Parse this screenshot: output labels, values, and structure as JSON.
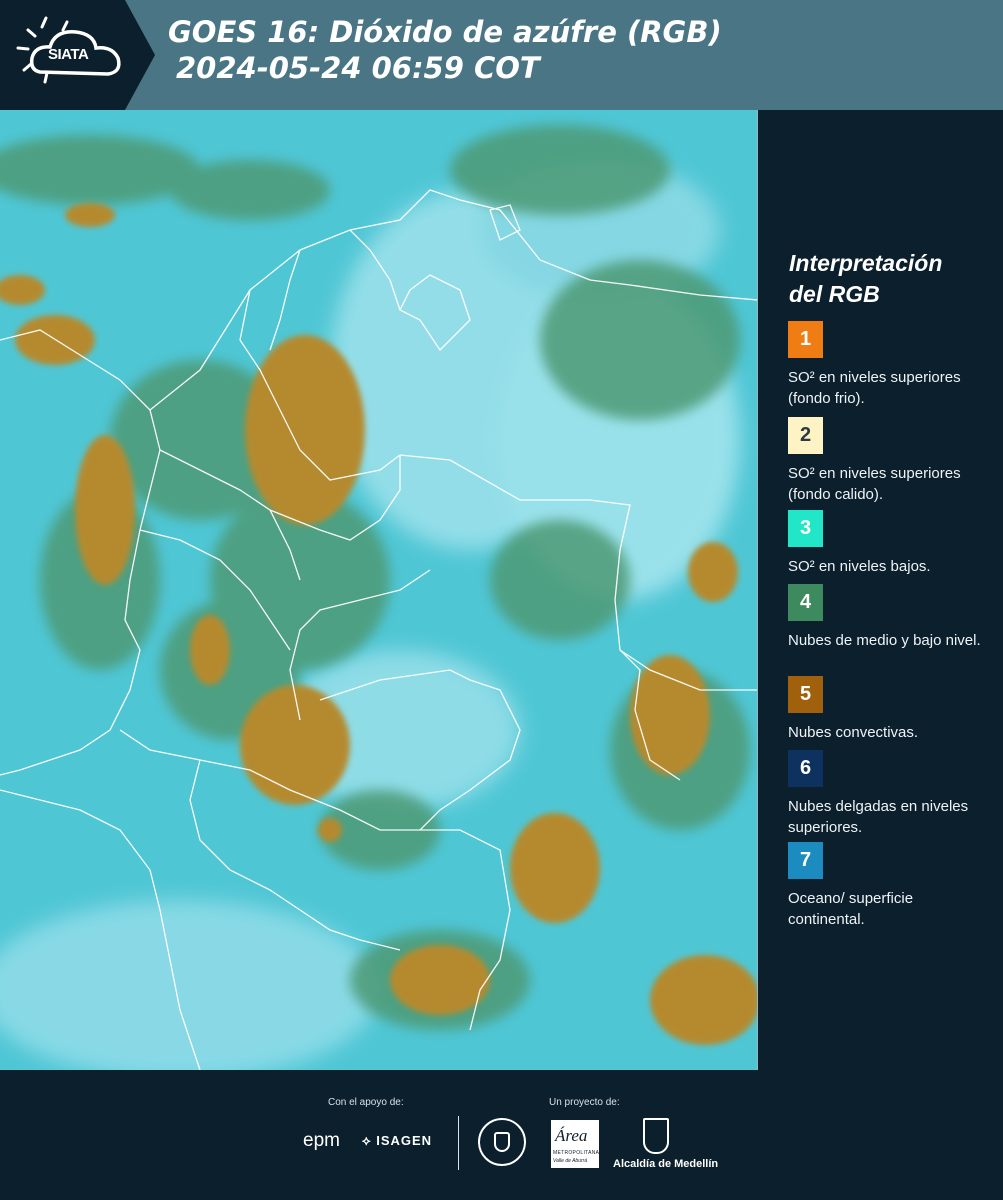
{
  "header": {
    "logo_text": "SIATA",
    "title_line1": "GOES 16: Dióxido de azúfre (RGB)",
    "title_line2": "2024-05-24 06:59 COT"
  },
  "legend": {
    "title_line1": "Interpretación",
    "title_line2": "del RGB",
    "items": [
      {
        "number": "1",
        "color": "#f07d14",
        "text": "SO² en niveles superiores (fondo frio)."
      },
      {
        "number": "2",
        "color": "#fdf3c4",
        "text": "SO² en niveles superiores (fondo calido)."
      },
      {
        "number": "3",
        "color": "#22e6c8",
        "text": "SO² en niveles bajos."
      },
      {
        "number": "4",
        "color": "#3d8a5e",
        "text": "Nubes de medio y bajo nivel."
      },
      {
        "number": "5",
        "color": "#a0600c",
        "text": "Nubes convectivas."
      },
      {
        "number": "6",
        "color": "#0d3260",
        "text": "Nubes delgadas en niveles superiores."
      },
      {
        "number": "7",
        "color": "#1c8cc0",
        "text": "Oceano/ superficie continental."
      }
    ]
  },
  "footer": {
    "support_label": "Con el apoyo de:",
    "project_label": "Un proyecto de:",
    "sponsor_epm": "epm",
    "sponsor_isagen": "ISAGEN",
    "area_text": "Área",
    "area_subtext": "METROPOLITANA",
    "area_subtext2": "Valle de Aburrá",
    "alcaldia_text": "Alcaldía de Medellín"
  }
}
